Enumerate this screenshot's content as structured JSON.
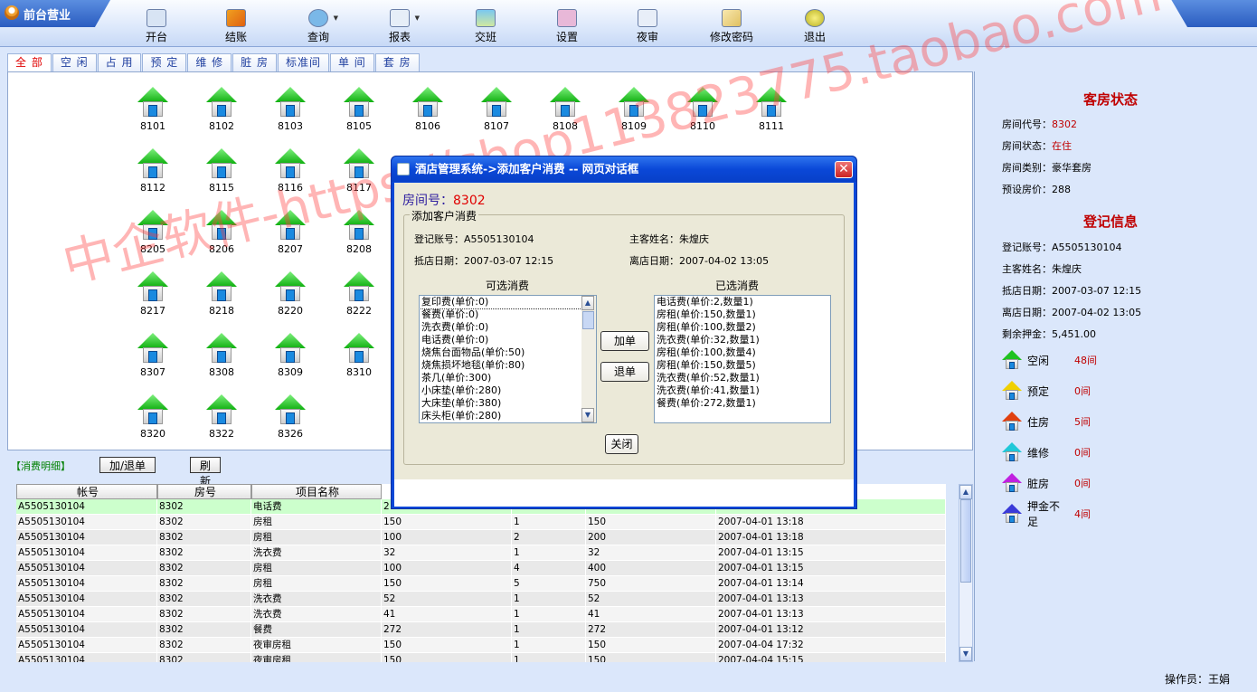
{
  "header": {
    "title": "前台营业"
  },
  "toolbar": {
    "items": [
      "开台",
      "结账",
      "查询",
      "报表",
      "交班",
      "设置",
      "夜审",
      "修改密码",
      "退出"
    ]
  },
  "tabs": [
    "全 部",
    "空 闲",
    "占 用",
    "预 定",
    "维 修",
    "脏 房",
    "标准间",
    "单 间",
    "套 房"
  ],
  "rooms": [
    [
      "8101",
      "8102",
      "8103",
      "8105",
      "8106",
      "8107",
      "8108",
      "8109",
      "8110",
      "8111"
    ],
    [
      "8112",
      "8115",
      "8116",
      "8117"
    ],
    [
      "8205",
      "8206",
      "8207",
      "8208"
    ],
    [
      "8217",
      "8218",
      "8220",
      "8222"
    ],
    [
      "8307",
      "8308",
      "8309",
      "8310"
    ],
    [
      "8320",
      "8322",
      "8326"
    ]
  ],
  "right_panel": {
    "room_status_title": "客房状态",
    "room_no_label": "房间代号：",
    "room_no": "8302",
    "state_label": "房间状态：",
    "state": "在住",
    "type_label": "房间类别：",
    "type": "豪华套房",
    "price_label": "预设房价：",
    "price": "288",
    "reg_title": "登记信息",
    "acct_label": "登记账号：",
    "acct": "A5505130104",
    "guest_label": "主客姓名：",
    "guest": "朱煌庆",
    "arrive_label": "抵店日期：",
    "arrive": "2007-03-07 12:15",
    "leave_label": "离店日期：",
    "leave": "2007-04-02 13:05",
    "deposit_label": "剩余押金：",
    "deposit": "5,451.00",
    "legend": [
      {
        "label": "空闲",
        "count": "48间",
        "color": "#1fc21f"
      },
      {
        "label": "预定",
        "count": "0间",
        "color": "#f0d000"
      },
      {
        "label": "住房",
        "count": "5间",
        "color": "#e04010"
      },
      {
        "label": "维修",
        "count": "0间",
        "color": "#20c8d8"
      },
      {
        "label": "脏房",
        "count": "0间",
        "color": "#c020e0"
      },
      {
        "label": "押金不足",
        "count": "4间",
        "color": "#3a3ad8"
      }
    ]
  },
  "detail": {
    "label": "【消费明细】",
    "add_btn": "加/退单",
    "refresh_btn": "刷新"
  },
  "table": {
    "headers": [
      "帐号",
      "房号",
      "项目名称"
    ],
    "rows": [
      [
        "A5505130104",
        "8302",
        "电话费",
        "2",
        "",
        "",
        ""
      ],
      [
        "A5505130104",
        "8302",
        "房租",
        "150",
        "1",
        "150",
        "2007-04-01 13:18"
      ],
      [
        "A5505130104",
        "8302",
        "房租",
        "100",
        "2",
        "200",
        "2007-04-01 13:18"
      ],
      [
        "A5505130104",
        "8302",
        "洗衣费",
        "32",
        "1",
        "32",
        "2007-04-01 13:15"
      ],
      [
        "A5505130104",
        "8302",
        "房租",
        "100",
        "4",
        "400",
        "2007-04-01 13:15"
      ],
      [
        "A5505130104",
        "8302",
        "房租",
        "150",
        "5",
        "750",
        "2007-04-01 13:14"
      ],
      [
        "A5505130104",
        "8302",
        "洗衣费",
        "52",
        "1",
        "52",
        "2007-04-01 13:13"
      ],
      [
        "A5505130104",
        "8302",
        "洗衣费",
        "41",
        "1",
        "41",
        "2007-04-01 13:13"
      ],
      [
        "A5505130104",
        "8302",
        "餐费",
        "272",
        "1",
        "272",
        "2007-04-01 13:12"
      ],
      [
        "A5505130104",
        "8302",
        "夜审房租",
        "150",
        "1",
        "150",
        "2007-04-04 17:32"
      ],
      [
        "A5505130104",
        "8302",
        "夜审房租",
        "150",
        "1",
        "150",
        "2007-04-04 15:15"
      ]
    ]
  },
  "status": {
    "operator": "操作员：王娟"
  },
  "dialog": {
    "title": "酒店管理系统->添加客户消费 -- 网页对话框",
    "room_label": "房间号：",
    "room_no": "8302",
    "fieldset": "添加客户消费",
    "acct_label": "登记账号：A5505130104",
    "guest_label": "主客姓名：朱煌庆",
    "arrive_label": "抵店日期：2007-03-07 12:15",
    "leave_label": "离店日期：2007-04-02 13:05",
    "available_title": "可选消费",
    "selected_title": "已选消费",
    "available": [
      "复印费(单价:0)",
      "餐费(单价:0)",
      "洗衣费(单价:0)",
      "电话费(单价:0)",
      "烧焦台面物品(单价:50)",
      "烧焦损坏地毯(单价:80)",
      "茶几(单价:300)",
      "小床垫(单价:280)",
      "大床垫(单价:380)",
      "床头柜(单价:280)"
    ],
    "selected": [
      "电话费(单价:2,数量1)",
      "房租(单价:150,数量1)",
      "房租(单价:100,数量2)",
      "洗衣费(单价:32,数量1)",
      "房租(单价:100,数量4)",
      "房租(单价:150,数量5)",
      "洗衣费(单价:52,数量1)",
      "洗衣费(单价:41,数量1)",
      "餐费(单价:272,数量1)"
    ],
    "add_btn": "加单",
    "remove_btn": "退单",
    "close_btn": "关闭"
  },
  "watermark": "中企软件-https://shop113823775.taobao.com"
}
